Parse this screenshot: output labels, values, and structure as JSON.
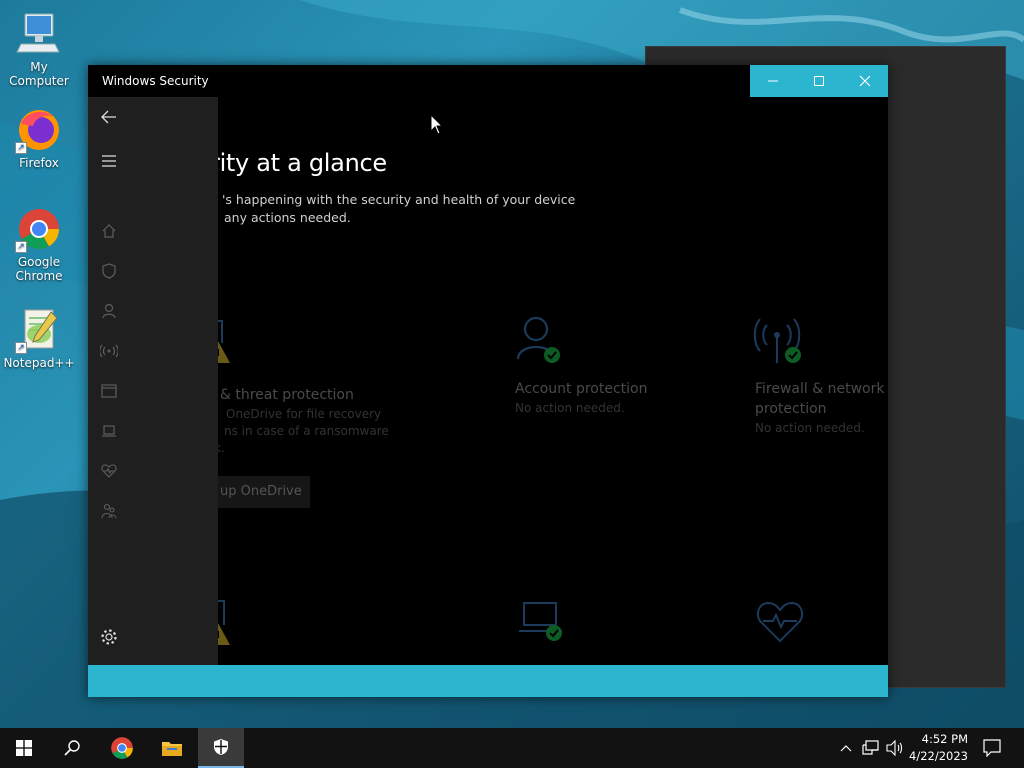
{
  "desktop": {
    "icons": [
      {
        "label": "My Computer",
        "icon": "computer-icon"
      },
      {
        "label": "Firefox",
        "icon": "firefox-icon"
      },
      {
        "label": "Google Chrome",
        "icon": "chrome-icon"
      },
      {
        "label": "Notepad++",
        "icon": "notepadpp-icon"
      }
    ]
  },
  "window": {
    "title": "Windows Security",
    "controls": {
      "minimize": "minimize-icon",
      "maximize": "maximize-icon",
      "close": "close-icon"
    },
    "accent_color": "#2bb5cf"
  },
  "sidebar": {
    "items": [
      {
        "icon": "back-arrow-icon"
      },
      {
        "icon": "hamburger-menu-icon"
      },
      {
        "icon": "home-icon"
      },
      {
        "icon": "shield-icon"
      },
      {
        "icon": "person-icon"
      },
      {
        "icon": "wireless-icon"
      },
      {
        "icon": "app-browser-icon"
      },
      {
        "icon": "laptop-icon"
      },
      {
        "icon": "heart-icon"
      },
      {
        "icon": "family-icon"
      },
      {
        "icon": "gear-icon"
      }
    ]
  },
  "main": {
    "heading": "rity at a glance",
    "subtitle_line1": "'s happening with the security and health of your device",
    "subtitle_line2": "any actions needed.",
    "tiles": [
      {
        "title": "& threat protection",
        "desc_line1": "OneDrive for file recovery",
        "desc_line2": "ns in case of a ransomware",
        "desc_line3": "k.",
        "button": "up OneDrive"
      },
      {
        "title": "Account protection",
        "status": "No action needed."
      },
      {
        "title_line1": "Firewall & network",
        "title_line2": "protection",
        "status": "No action needed."
      }
    ]
  },
  "taskbar": {
    "time": "4:52 PM",
    "date": "4/22/2023"
  }
}
